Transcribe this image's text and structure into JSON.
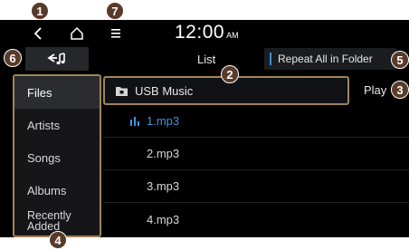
{
  "status": {
    "time": "12:00",
    "ampm": "AM"
  },
  "header": {
    "title": "List",
    "repeat_mode": "Repeat All in Folder"
  },
  "sidebar": {
    "items": [
      {
        "label": "Files",
        "active": true
      },
      {
        "label": "Artists"
      },
      {
        "label": "Songs"
      },
      {
        "label": "Albums"
      },
      {
        "label": "Recently Added",
        "line1": "Recently",
        "line2": "Added"
      }
    ]
  },
  "folder": {
    "label": "USB Music"
  },
  "play_label": "Play",
  "files": [
    {
      "name": "1.mp3",
      "playing": true
    },
    {
      "name": "2.mp3"
    },
    {
      "name": "3.mp3"
    },
    {
      "name": "4.mp3"
    }
  ],
  "callouts": [
    "1",
    "2",
    "3",
    "4",
    "5",
    "6",
    "7"
  ],
  "colors": {
    "accent_blue": "#3d95e0",
    "highlight_border": "#a0855b",
    "callout_bg": "#5a3a2a"
  }
}
